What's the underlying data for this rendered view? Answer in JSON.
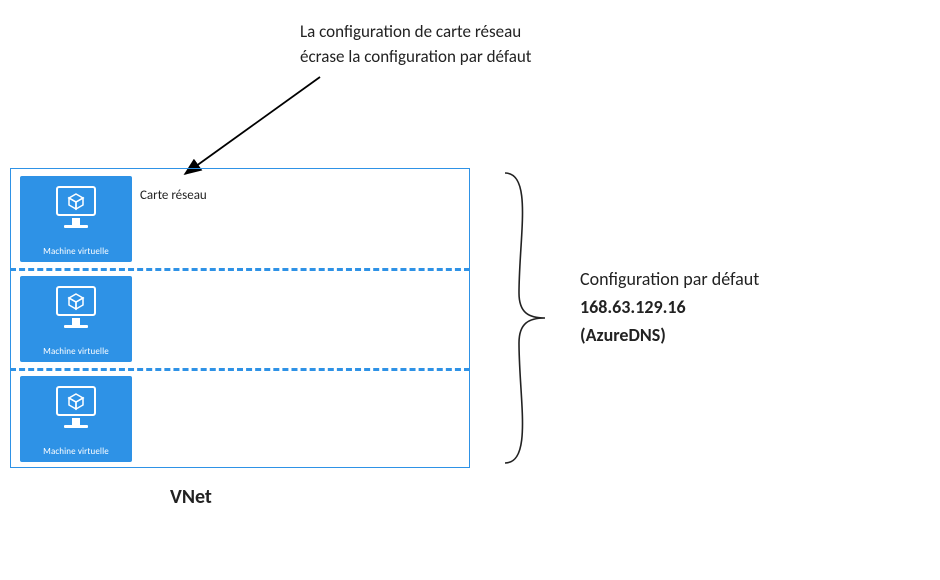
{
  "caption": {
    "line1": "La configuration de carte réseau",
    "line2": "écrase la configuration par défaut"
  },
  "vm_label": "Machine virtuelle",
  "nic_label": "Carte réseau",
  "vnet_label": "VNet",
  "default_config": {
    "title": "Configuration par défaut",
    "ip": "168.63.129.16",
    "name": "(AzureDNS)"
  }
}
